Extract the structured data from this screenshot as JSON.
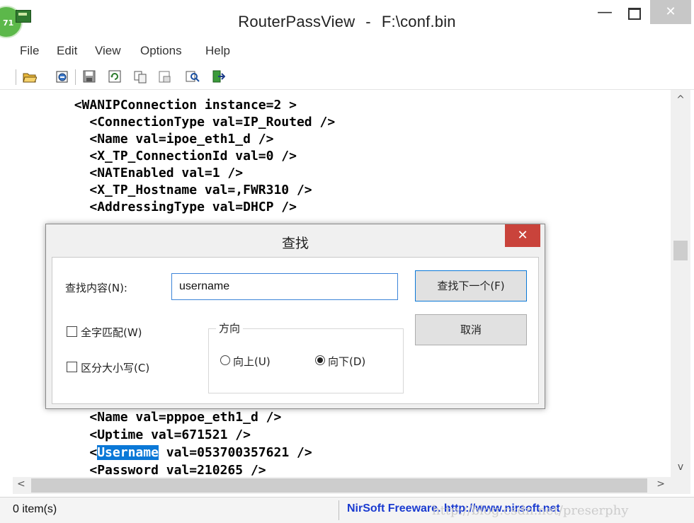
{
  "window": {
    "badge": "71",
    "title": "RouterPassView",
    "title_sep": "-",
    "title_file": "F:\\conf.bin",
    "minimize": "—",
    "close": "✕"
  },
  "menu": [
    "File",
    "Edit",
    "View",
    "Options",
    "Help"
  ],
  "toolbar": {
    "icons": [
      "open-icon",
      "open-alt-icon",
      "save-icon",
      "refresh-icon",
      "copy-icon",
      "properties-icon",
      "find-icon",
      "exit-icon"
    ]
  },
  "content": {
    "lines": [
      "        <WANIPConnection instance=2 >",
      "          <ConnectionType val=IP_Routed />",
      "          <Name val=ipoe_eth1_d />",
      "          <X_TP_ConnectionId val=0 />",
      "          <NATEnabled val=1 />",
      "          <X_TP_Hostname val=,FWR310 />",
      "          <AddressingType val=DHCP />",
      "          <Name val=pppoe_eth1_d />",
      "          <Uptime val=671521 />"
    ],
    "username_line": {
      "prefix": "          <",
      "highlight": "Username",
      "suffix": " val=053700357621 />"
    },
    "password_line": "          <Password val=210265 />"
  },
  "scrollbars": {
    "up": "^",
    "down": "v",
    "left": "<",
    "right": ">"
  },
  "status": {
    "count": "0 item(s)",
    "link": "NirSoft Freeware.  http://www.nirsoft.net",
    "watermark": "http://blog.csdn.net/preserphy"
  },
  "find_dialog": {
    "title": "查找",
    "close": "✕",
    "find_label": "查找内容(N):",
    "find_value": "username",
    "find_next": "查找下一个(F)",
    "cancel": "取消",
    "match_whole_word": "全字匹配(W)",
    "match_case": "区分大小写(C)",
    "direction_label": "方向",
    "direction_up": "向上(U)",
    "direction_down": "向下(D)",
    "direction_selected": "down"
  },
  "colors": {
    "highlight": "#0a78d7",
    "close_red": "#c9433b",
    "badge_green": "#5cb84a",
    "link_blue": "#1a3bd0"
  }
}
